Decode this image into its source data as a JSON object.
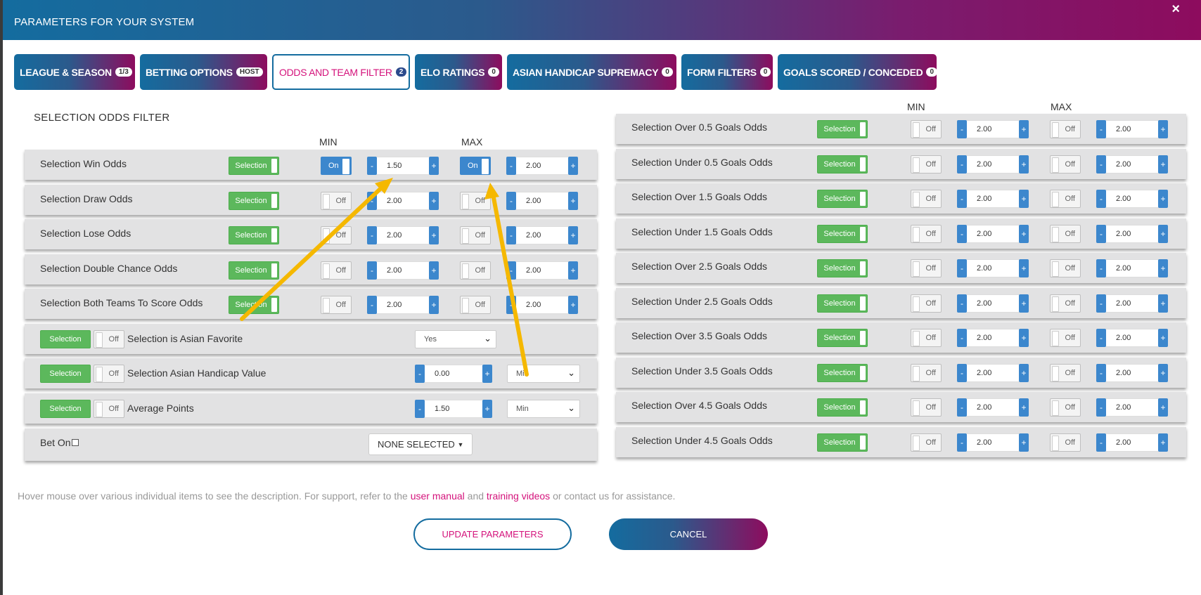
{
  "header": {
    "title": "PARAMETERS FOR YOUR SYSTEM",
    "close_icon": "×"
  },
  "tabs": [
    {
      "label": "LEAGUE & SEASON",
      "badge": "1/3"
    },
    {
      "label": "BETTING OPTIONS",
      "badge": "HOST"
    },
    {
      "label": "ODDS AND TEAM FILTER",
      "badge": "2",
      "active": true
    },
    {
      "label": "ELO RATINGS",
      "badge": "0"
    },
    {
      "label": "ASIAN HANDICAP SUPREMACY",
      "badge": "0"
    },
    {
      "label": "FORM FILTERS",
      "badge": "0"
    },
    {
      "label": "GOALS SCORED / CONCEDED",
      "badge": "0"
    }
  ],
  "left": {
    "section_title": "SELECTION ODDS FILTER",
    "min_label": "MIN",
    "max_label": "MAX",
    "rows": [
      {
        "label": "Selection Win Odds",
        "selection": "Selection",
        "min_toggle": "On",
        "min_value": "1.50",
        "max_toggle": "On",
        "max_value": "2.00"
      },
      {
        "label": "Selection Draw Odds",
        "selection": "Selection",
        "min_toggle": "Off",
        "min_value": "2.00",
        "max_toggle": "Off",
        "max_value": "2.00"
      },
      {
        "label": "Selection Lose Odds",
        "selection": "Selection",
        "min_toggle": "Off",
        "min_value": "2.00",
        "max_toggle": "Off",
        "max_value": "2.00"
      },
      {
        "label": "Selection Double Chance Odds",
        "selection": "Selection",
        "min_toggle": "Off",
        "min_value": "2.00",
        "max_toggle": "Off",
        "max_value": "2.00"
      },
      {
        "label": "Selection Both Teams To Score Odds",
        "selection": "Selection",
        "min_toggle": "Off",
        "min_value": "2.00",
        "max_toggle": "Off",
        "max_value": "2.00"
      }
    ],
    "asian_favorite": {
      "selection": "Selection",
      "toggle": "Off",
      "label": "Selection is Asian Favorite",
      "value": "Yes"
    },
    "asian_handicap": {
      "selection": "Selection",
      "toggle": "Off",
      "label": "Selection Asian Handicap Value",
      "value": "0.00",
      "select": "Min"
    },
    "average_points": {
      "selection": "Selection",
      "toggle": "Off",
      "label": "Average Points",
      "value": "1.50",
      "select": "Min"
    },
    "bet_on": {
      "label": "Bet On",
      "dropdown": "NONE SELECTED"
    }
  },
  "right": {
    "min_label": "MIN",
    "max_label": "MAX",
    "rows": [
      {
        "label": "Selection Over 0.5 Goals Odds",
        "selection": "Selection",
        "min_toggle": "Off",
        "min_value": "2.00",
        "max_toggle": "Off",
        "max_value": "2.00"
      },
      {
        "label": "Selection Under 0.5 Goals Odds",
        "selection": "Selection",
        "min_toggle": "Off",
        "min_value": "2.00",
        "max_toggle": "Off",
        "max_value": "2.00"
      },
      {
        "label": "Selection Over 1.5 Goals Odds",
        "selection": "Selection",
        "min_toggle": "Off",
        "min_value": "2.00",
        "max_toggle": "Off",
        "max_value": "2.00"
      },
      {
        "label": "Selection Under 1.5 Goals Odds",
        "selection": "Selection",
        "min_toggle": "Off",
        "min_value": "2.00",
        "max_toggle": "Off",
        "max_value": "2.00"
      },
      {
        "label": "Selection Over 2.5 Goals Odds",
        "selection": "Selection",
        "min_toggle": "Off",
        "min_value": "2.00",
        "max_toggle": "Off",
        "max_value": "2.00"
      },
      {
        "label": "Selection Under 2.5 Goals Odds",
        "selection": "Selection",
        "min_toggle": "Off",
        "min_value": "2.00",
        "max_toggle": "Off",
        "max_value": "2.00"
      },
      {
        "label": "Selection Over 3.5 Goals Odds",
        "selection": "Selection",
        "min_toggle": "Off",
        "min_value": "2.00",
        "max_toggle": "Off",
        "max_value": "2.00"
      },
      {
        "label": "Selection Under 3.5 Goals Odds",
        "selection": "Selection",
        "min_toggle": "Off",
        "min_value": "2.00",
        "max_toggle": "Off",
        "max_value": "2.00"
      },
      {
        "label": "Selection Over 4.5 Goals Odds",
        "selection": "Selection",
        "min_toggle": "Off",
        "min_value": "2.00",
        "max_toggle": "Off",
        "max_value": "2.00"
      },
      {
        "label": "Selection Under 4.5 Goals Odds",
        "selection": "Selection",
        "min_toggle": "Off",
        "min_value": "2.00",
        "max_toggle": "Off",
        "max_value": "2.00"
      }
    ]
  },
  "stepper": {
    "minus": "-",
    "plus": "+"
  },
  "footer": {
    "note_start": "Hover mouse over various individual items to see the description. For support, refer to the ",
    "manual_link": "user manual",
    "and": " and ",
    "videos_link": "training videos",
    "note_end": " or contact us for assistance.",
    "update_button": "UPDATE PARAMETERS",
    "cancel_button": "CANCEL"
  },
  "colors": {
    "accent_pink": "#d4127b",
    "brand_blue": "#146c9f",
    "selection_green": "#5cb85c",
    "annotation_arrow": "#f5b800"
  }
}
